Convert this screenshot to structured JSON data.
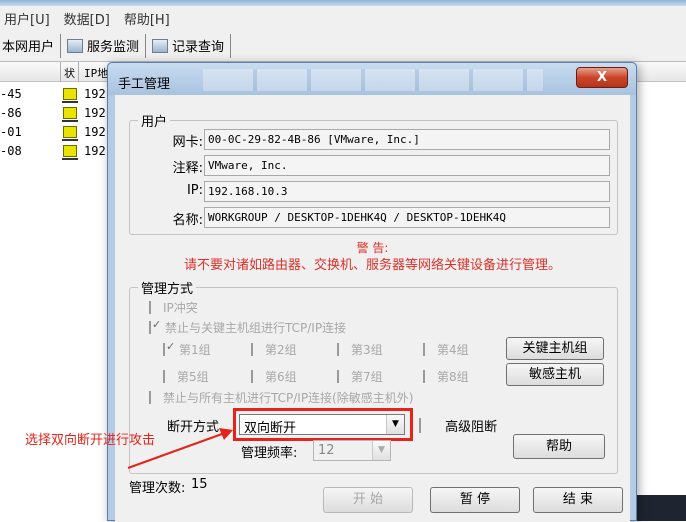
{
  "menu": [
    "用户[U]",
    "数据[D]",
    "帮助[H]"
  ],
  "tabs": [
    "本网用户",
    "服务监测",
    "记录查询"
  ],
  "list": {
    "headers": [
      "状",
      "IP地"
    ],
    "rows": [
      {
        "mac": "-45",
        "ip": "192"
      },
      {
        "mac": "-86",
        "ip": "192"
      },
      {
        "mac": "-01",
        "ip": "192"
      },
      {
        "mac": "-08",
        "ip": "192"
      }
    ]
  },
  "dialog": {
    "title": "手工管理",
    "close": "X",
    "user_group": "用户",
    "fields": [
      {
        "label": "网卡:",
        "value": "00-0C-29-82-4B-86 [VMware, Inc.]"
      },
      {
        "label": "注释:",
        "value": "VMware, Inc."
      },
      {
        "label": "IP:",
        "value": "192.168.10.3"
      },
      {
        "label": "名称:",
        "value": "WORKGROUP / DESKTOP-1DEHK4Q / DESKTOP-1DEHK4Q"
      }
    ],
    "warning_title": "警 告:",
    "warning_text": "请不要对诸如路由器、交换机、服务器等网络关键设备进行管理。",
    "manage_group": "管理方式",
    "opt_ip_conflict": "IP冲突",
    "opt_block_key": "禁止与关键主机组进行TCP/IP连接",
    "groups": [
      "第1组",
      "第2组",
      "第3组",
      "第4组",
      "第5组",
      "第6组",
      "第7组",
      "第8组"
    ],
    "opt_block_all": "禁止与所有主机进行TCP/IP连接(除敏感主机外)",
    "btn_key_hosts": "关键主机组",
    "btn_sensitive": "敏感主机",
    "disconnect_label": "断开方式",
    "disconnect_value": "双向断开",
    "advanced_block": "高级阻断",
    "freq_label": "管理频率:",
    "freq_value": "12",
    "help": "帮助",
    "count_label": "管理次数:",
    "count_value": "15",
    "btn_start": "开 始",
    "btn_pause": "暂 停",
    "btn_end": "结 束"
  },
  "annotation": "选择双向断开进行攻击",
  "colors": {
    "warning": "#e0302a",
    "annotation": "#e5231b"
  }
}
